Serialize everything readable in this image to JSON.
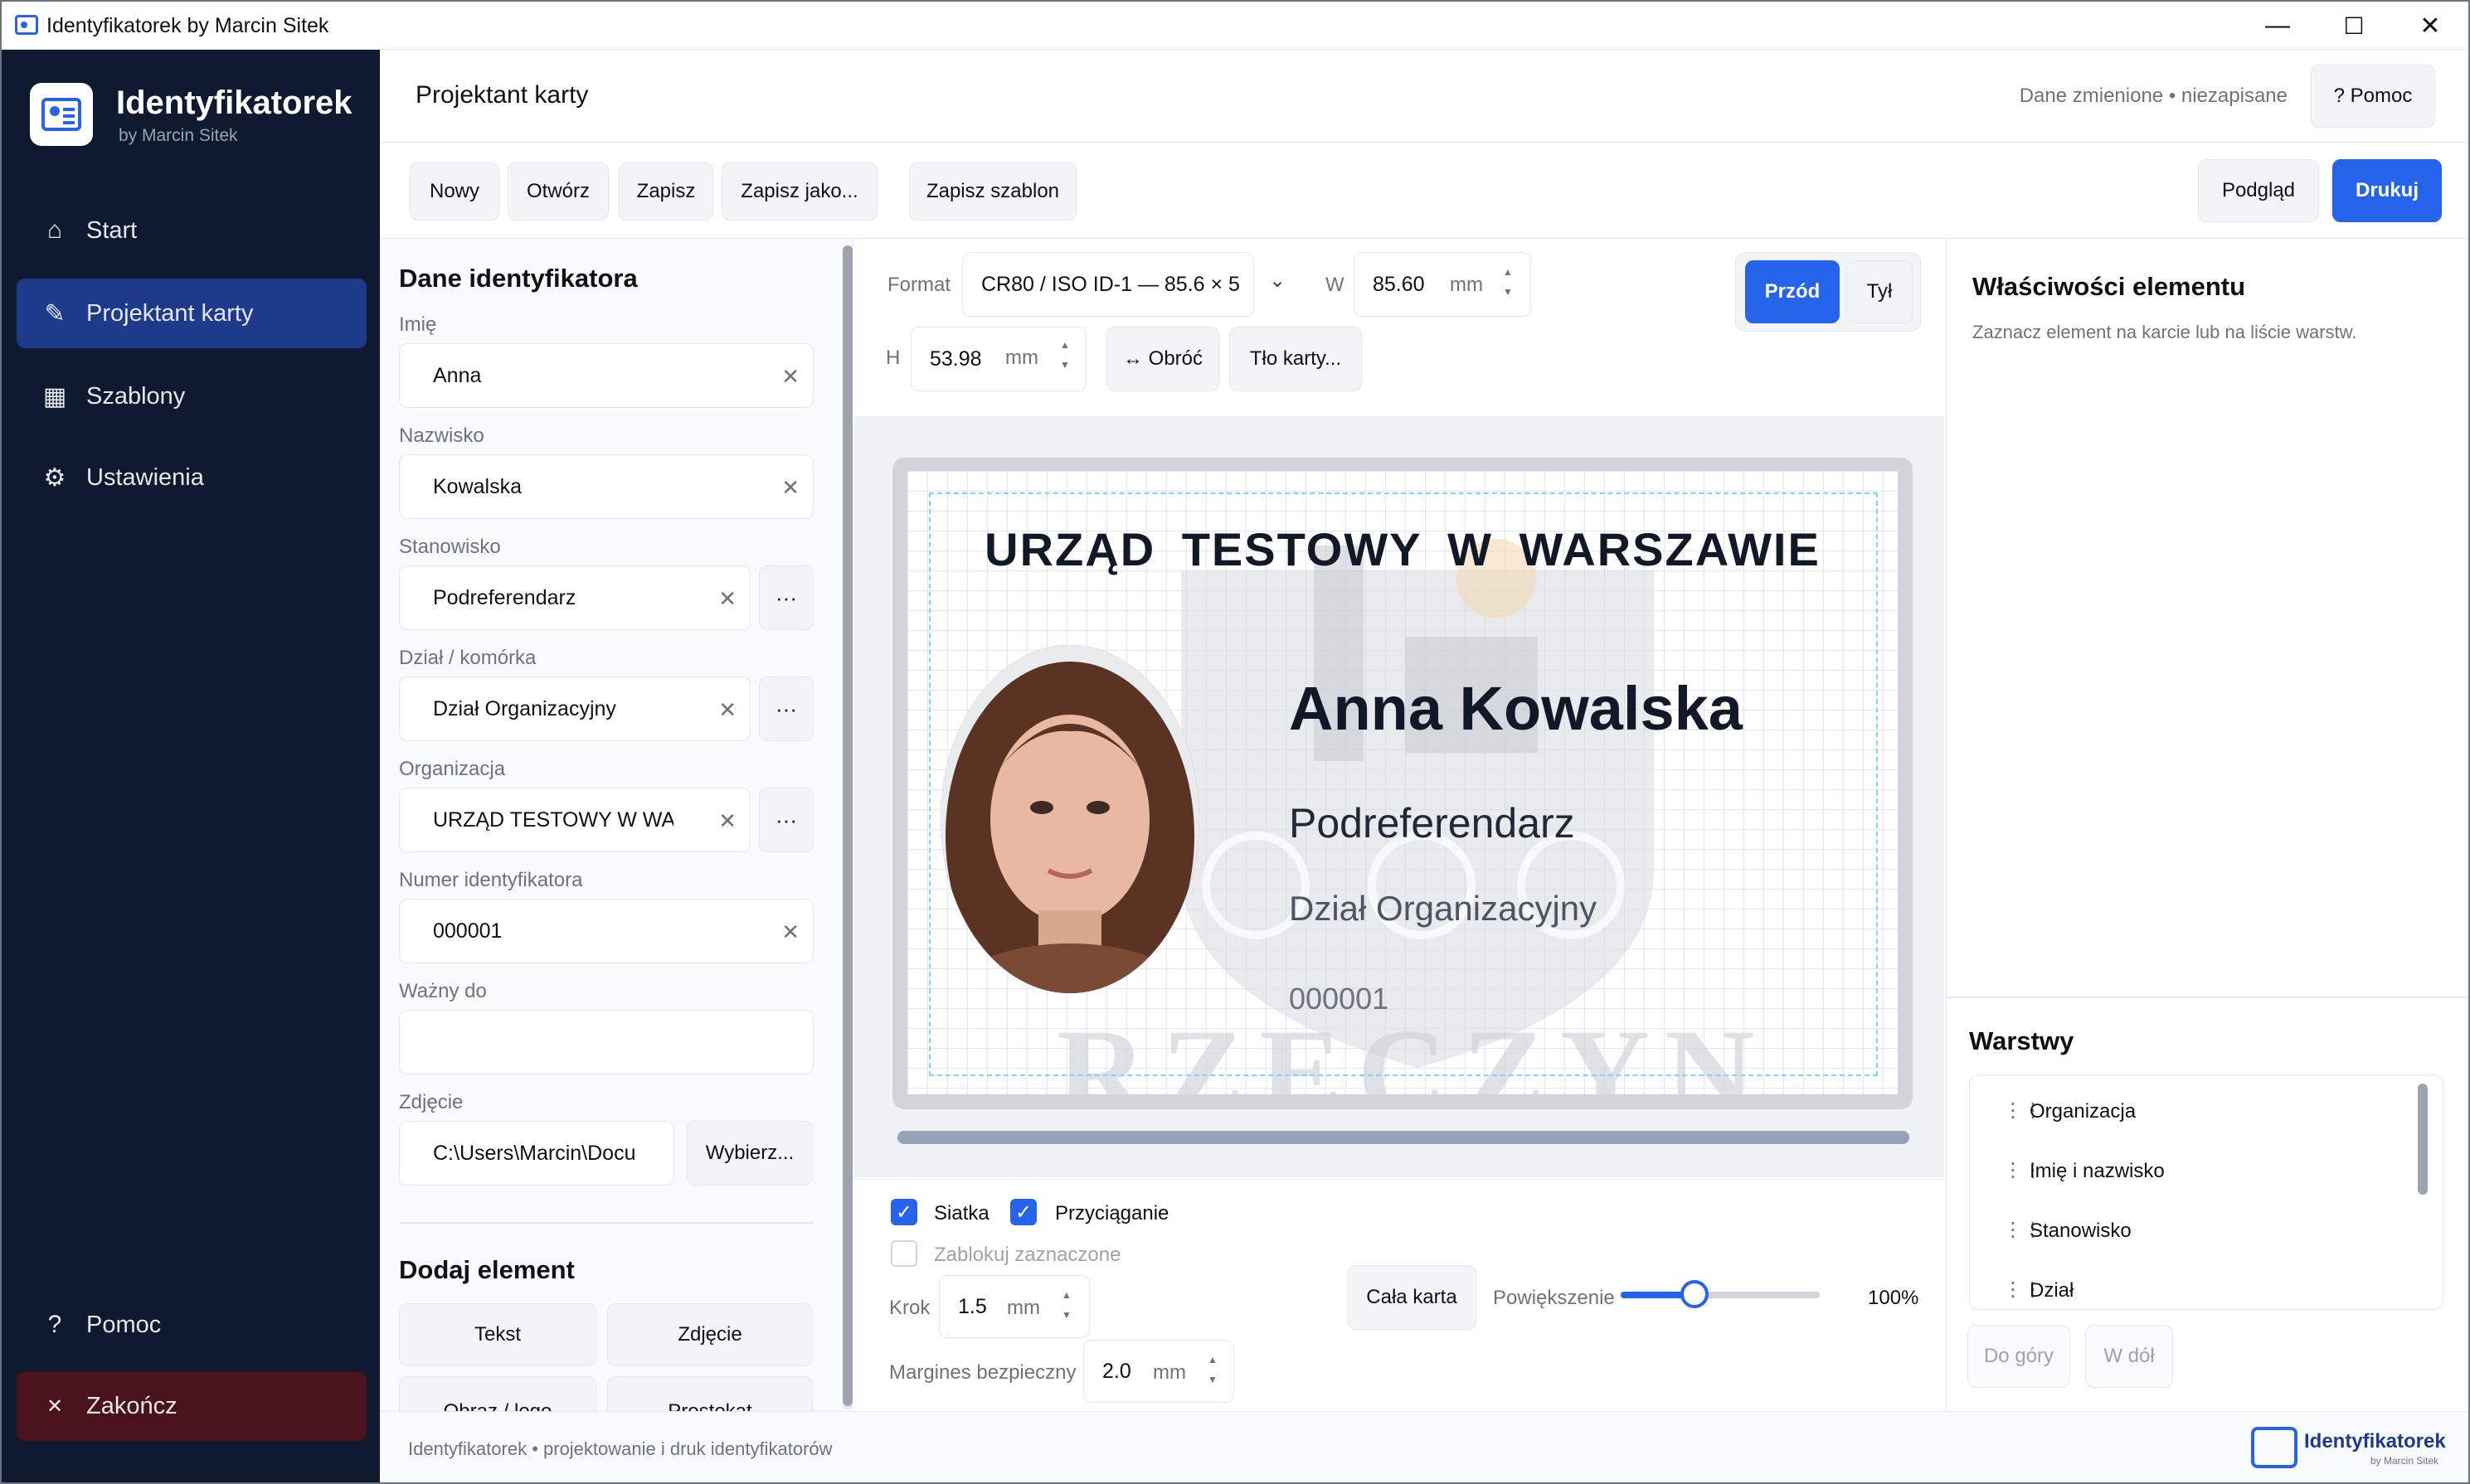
{
  "window": {
    "title": "Identyfikatorek by Marcin Sitek",
    "minimize": "—",
    "maximize": "☐",
    "close": "✕"
  },
  "sidebar": {
    "brand": "Identyfikatorek",
    "brand_sub": "by Marcin Sitek",
    "items": [
      {
        "label": "Start",
        "icon": "home-icon",
        "glyph": "⌂"
      },
      {
        "label": "Projektant karty",
        "icon": "pencil-icon",
        "glyph": "✎"
      },
      {
        "label": "Szablony",
        "icon": "grid-icon",
        "glyph": "▦"
      },
      {
        "label": "Ustawienia",
        "icon": "gear-icon",
        "glyph": "⚙"
      }
    ],
    "help": {
      "label": "Pomoc",
      "glyph": "?"
    },
    "quit": {
      "label": "Zakończ",
      "glyph": "✕"
    }
  },
  "header": {
    "title": "Projektant karty",
    "status": "Dane zmienione • niezapisane",
    "help_button": "?  Pomoc"
  },
  "toolbar": {
    "new": "Nowy",
    "open": "Otwórz",
    "save": "Zapisz",
    "save_as": "Zapisz jako...",
    "save_template": "Zapisz szablon",
    "preview": "Podgląd",
    "print": "Drukuj"
  },
  "form": {
    "heading": "Dane identyfikatora",
    "fields": [
      {
        "label": "Imię",
        "value": "Anna"
      },
      {
        "label": "Nazwisko",
        "value": "Kowalska"
      },
      {
        "label": "Stanowisko",
        "value": "Podreferendarz"
      },
      {
        "label": "Dział / komórka",
        "value": "Dział Organizacyjny"
      },
      {
        "label": "Organizacja",
        "value": "URZĄD TESTOWY W WAF"
      },
      {
        "label": "Numer identyfikatora",
        "value": "000001"
      },
      {
        "label": "Ważny do",
        "value": ""
      },
      {
        "label": "Zdjęcie",
        "value": "C:\\Users\\Marcin\\Docu"
      }
    ],
    "clear_glyph": "✕",
    "more_glyph": "···",
    "choose_button": "Wybierz...",
    "add_heading": "Dodaj element",
    "add_buttons": [
      "Tekst",
      "Zdjęcie",
      "Obraz / logo",
      "Prostokąt"
    ]
  },
  "format_bar": {
    "format_label": "Format",
    "format_value": "CR80 / ISO ID-1 — 85.6 × 5",
    "w_label": "W",
    "w_value": "85.60",
    "h_label": "H",
    "h_value": "53.98",
    "unit": "mm",
    "rotate": "↔ Obróć",
    "background": "Tło karty...",
    "front": "Przód",
    "back": "Tył"
  },
  "card": {
    "organization": "URZĄD TESTOWY W WARSZAWIE",
    "name": "Anna Kowalska",
    "position": "Podreferendarz",
    "department": "Dział Organizacyjny",
    "number": "000001",
    "watermark": "RZECZYN"
  },
  "bottom": {
    "grid": "Siatka",
    "snap": "Przyciąganie",
    "lock": "Zablokuj zaznaczone",
    "step_label": "Krok",
    "step_value": "1.5",
    "margin_label": "Margines bezpieczny",
    "margin_value": "2.0",
    "unit": "mm",
    "whole_card": "Cała karta",
    "zoom_label": "Powiększenie",
    "zoom_value": "100%",
    "zoom_fraction": 0.37
  },
  "properties": {
    "title": "Właściwości elementu",
    "hint": "Zaznacz element na karcie lub na liście warstw."
  },
  "layers": {
    "title": "Warstwy",
    "items": [
      "Organizacja",
      "Imię i nazwisko",
      "Stanowisko",
      "Dział"
    ],
    "up": "Do góry",
    "down": "W dół",
    "grip": "⋮⋮"
  },
  "footer": {
    "text": "Identyfikatorek • projektowanie i druk identyfikatorów",
    "logo_text": "Identyfikatorek",
    "logo_sub": "by Marcin Sitek"
  },
  "colors": {
    "accent": "#2563eb",
    "sidebar": "#0f1a30",
    "active": "#1e3a8a"
  }
}
